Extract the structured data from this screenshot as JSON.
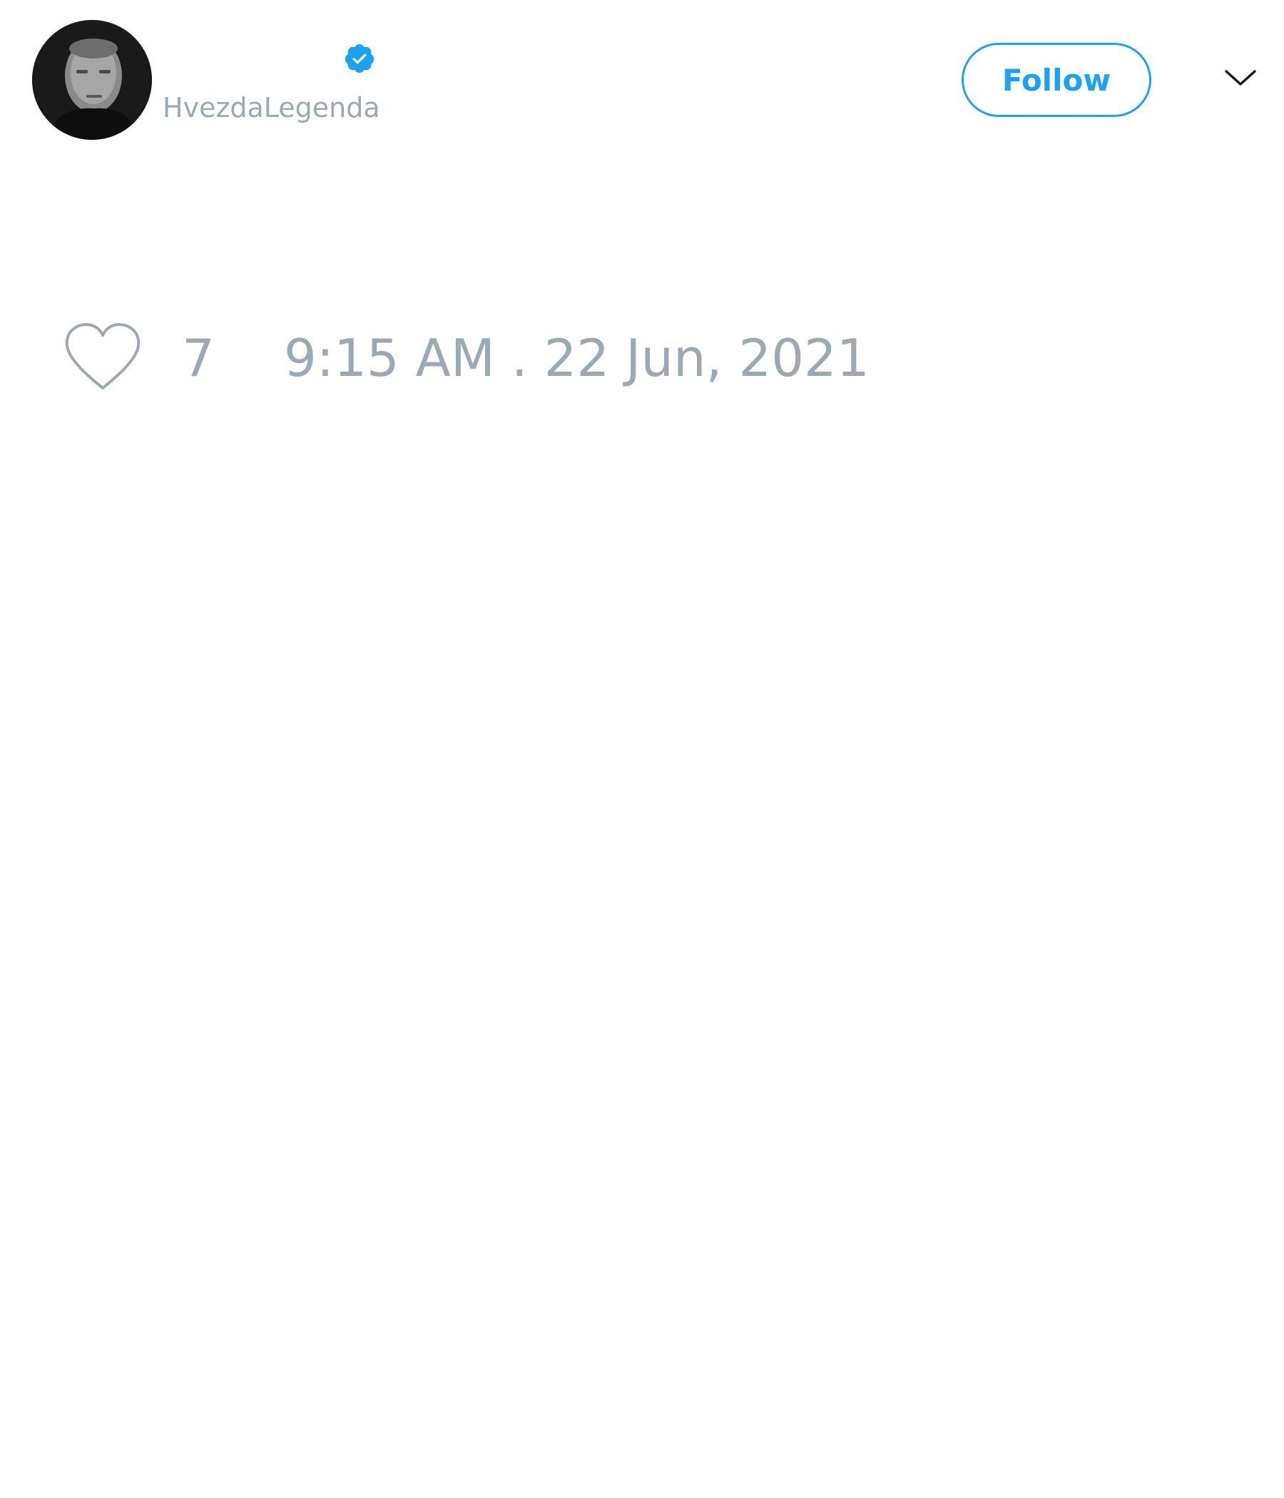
{
  "author": {
    "display_name": "",
    "username": "HvezdaLegenda",
    "verified": true,
    "avatar_icon": "profile-photo"
  },
  "actions": {
    "follow_label": "Follow",
    "menu_icon": "chevron-down-icon"
  },
  "stats": {
    "like_icon": "heart-icon",
    "like_count": "7",
    "timestamp": "9:15 AM . 22 Jun, 2021"
  },
  "colors": {
    "accent": "#1da1f2",
    "muted_text": "#99aab5",
    "background": "#ffffff"
  }
}
